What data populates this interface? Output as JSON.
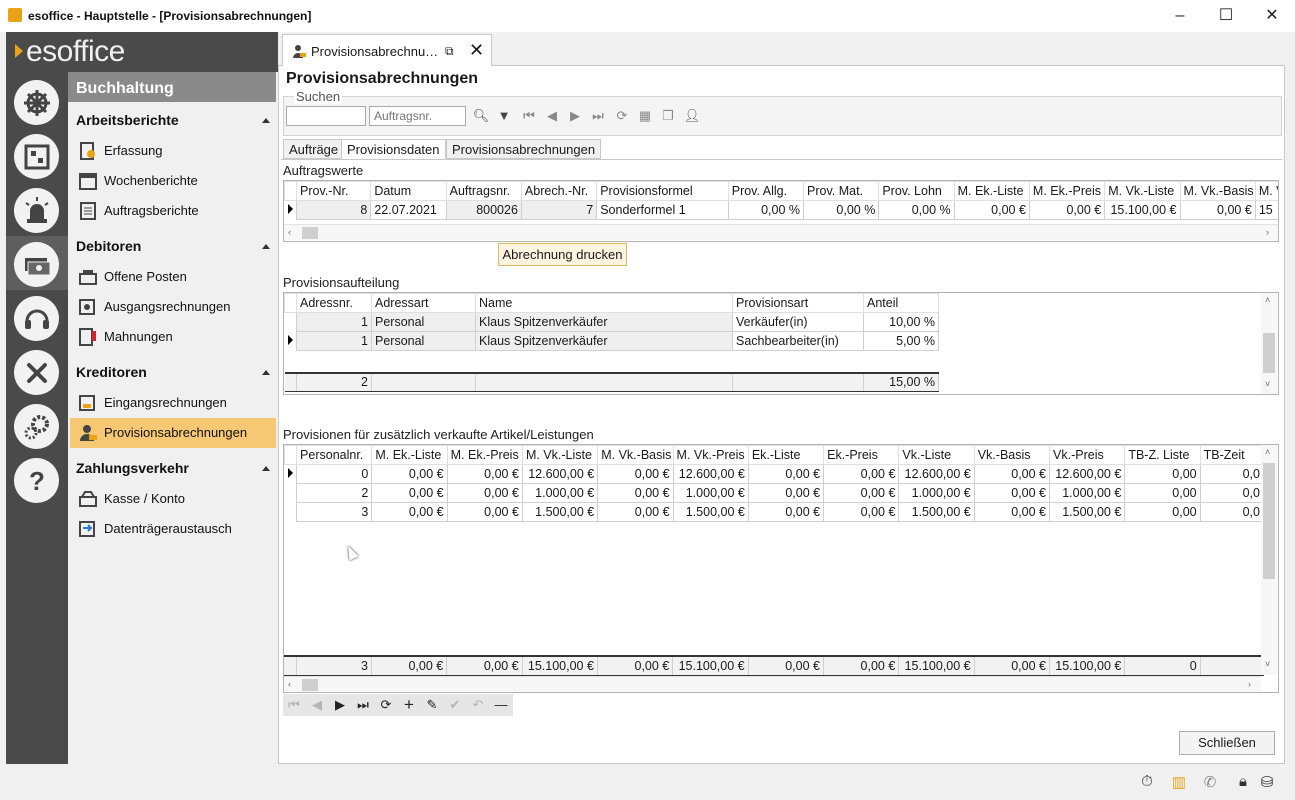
{
  "window": {
    "title": "esoffice - Hauptstelle - [Provisionsabrechnungen]",
    "minimize": "–",
    "maximize": "☐",
    "close": "✕"
  },
  "brand": {
    "logo_text": "esoffice",
    "accent": "#e8a317"
  },
  "rail": {
    "icons": [
      "steering-wheel-icon",
      "board-icon",
      "alarm-light-icon",
      "money-icon",
      "headset-icon",
      "tools-icon",
      "gears-icon",
      "help-icon"
    ]
  },
  "nav": {
    "header": "Buchhaltung",
    "sections": [
      {
        "title": "Arbeitsberichte",
        "items": [
          "Erfassung",
          "Wochenberichte",
          "Auftragsberichte"
        ]
      },
      {
        "title": "Debitoren",
        "items": [
          "Offene Posten",
          "Ausgangsrechnungen",
          "Mahnungen"
        ]
      },
      {
        "title": "Kreditoren",
        "items": [
          "Eingangsrechnungen",
          "Provisionsabrechnungen"
        ]
      },
      {
        "title": "Zahlungsverkehr",
        "items": [
          "Kasse / Konto",
          "Datenträgeraustausch"
        ]
      }
    ],
    "selected": "Provisionsabrechnungen"
  },
  "doc_tab": {
    "label": "Provisionsabrechnu…",
    "open_external": "⧉",
    "close": "✕"
  },
  "page_title": "Provisionsabrechnungen",
  "search": {
    "legend": "Suchen",
    "field1_value": "",
    "field2_placeholder": "Auftragsnr."
  },
  "tabs": [
    "Aufträge",
    "Provisionsdaten",
    "Provisionsabrechnungen"
  ],
  "active_tab": "Provisionsdaten",
  "auftragswerte": {
    "label": "Auftragswerte",
    "columns": [
      "Prov.-Nr.",
      "Datum",
      "Auftragsnr.",
      "Abrech.-Nr.",
      "Provisionsformel",
      "Prov. Allg.",
      "Prov. Mat.",
      "Prov. Lohn",
      "M. Ek.-Liste",
      "M. Ek.-Preis",
      "M. Vk.-Liste",
      "M. Vk.-Basis",
      "M. V"
    ],
    "rows": [
      [
        "8",
        "22.07.2021",
        "800026",
        "7",
        "Sonderformel 1",
        "0,00 %",
        "0,00 %",
        "0,00 %",
        "0,00 €",
        "0,00 €",
        "15.100,00 €",
        "0,00 €",
        "15"
      ]
    ]
  },
  "print_button": "Abrechnung drucken",
  "aufteilung": {
    "label": "Provisionsaufteilung",
    "columns": [
      "Adressnr.",
      "Adressart",
      "Name",
      "Provisionsart",
      "Anteil"
    ],
    "rows": [
      [
        "1",
        "Personal",
        "Klaus Spitzenverkäufer",
        "Verkäufer(in)",
        "10,00 %"
      ],
      [
        "1",
        "Personal",
        "Klaus Spitzenverkäufer",
        "Sachbearbeiter(in)",
        "5,00 %"
      ]
    ],
    "footer": [
      "2",
      "",
      "",
      "",
      "15,00 %"
    ]
  },
  "zusatz": {
    "label": "Provisionen für zusätzlich verkaufte Artikel/Leistungen",
    "columns": [
      "Personalnr.",
      "M. Ek.-Liste",
      "M. Ek.-Preis",
      "M. Vk.-Liste",
      "M. Vk.-Basis",
      "M. Vk.-Preis",
      "Ek.-Liste",
      "Ek.-Preis",
      "Vk.-Liste",
      "Vk.-Basis",
      "Vk.-Preis",
      "TB-Z. Liste",
      "TB-Zeit"
    ],
    "rows": [
      [
        "0",
        "0,00 €",
        "0,00 €",
        "12.600,00 €",
        "0,00 €",
        "12.600,00 €",
        "0,00 €",
        "0,00 €",
        "12.600,00 €",
        "0,00 €",
        "12.600,00 €",
        "0,00",
        "0,0"
      ],
      [
        "2",
        "0,00 €",
        "0,00 €",
        "1.000,00 €",
        "0,00 €",
        "1.000,00 €",
        "0,00 €",
        "0,00 €",
        "1.000,00 €",
        "0,00 €",
        "1.000,00 €",
        "0,00",
        "0,0"
      ],
      [
        "3",
        "0,00 €",
        "0,00 €",
        "1.500,00 €",
        "0,00 €",
        "1.500,00 €",
        "0,00 €",
        "0,00 €",
        "1.500,00 €",
        "0,00 €",
        "1.500,00 €",
        "0,00",
        "0,0"
      ]
    ],
    "footer": [
      "3",
      "0,00 €",
      "0,00 €",
      "15.100,00 €",
      "0,00 €",
      "15.100,00 €",
      "0,00 €",
      "0,00 €",
      "15.100,00 €",
      "0,00 €",
      "15.100,00 €",
      "0",
      ""
    ]
  },
  "navigator": {
    "buttons": [
      "first",
      "prior",
      "next",
      "last",
      "refresh",
      "insert",
      "edit",
      "post",
      "cancel",
      "delete"
    ],
    "glyphs": [
      "⏮",
      "◀",
      "▶",
      "⏭",
      "⟳",
      "+",
      "✎",
      "✔",
      "↶",
      "—"
    ]
  },
  "close_button": "Schließen",
  "status_icons": [
    "stopwatch-icon",
    "building-icon",
    "phone-icon",
    "lock-icon",
    "database-icon"
  ]
}
